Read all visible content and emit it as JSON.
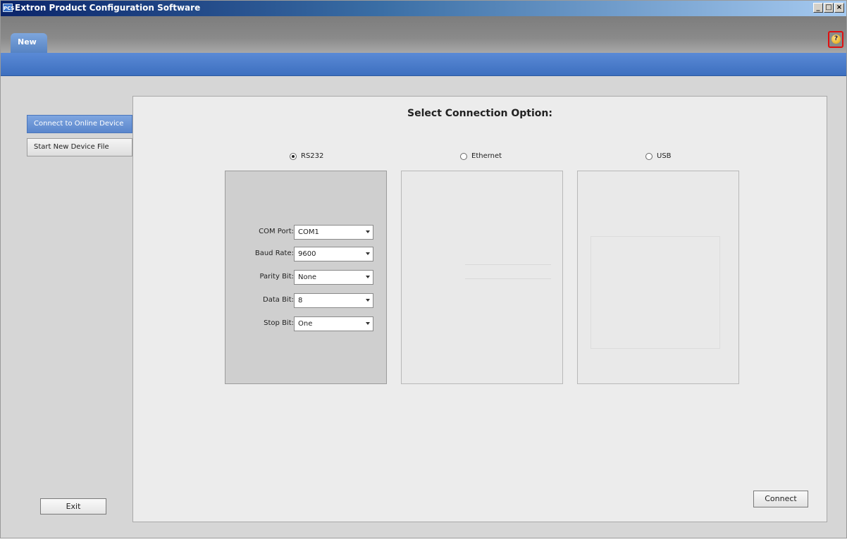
{
  "window": {
    "title": "Extron Product Configuration Software",
    "icon": "PCS"
  },
  "window_controls": {
    "minimize": "_",
    "maximize": "□",
    "close": "×"
  },
  "tabs": [
    {
      "label": "New"
    }
  ],
  "help": {
    "label": "?"
  },
  "sidebar": {
    "items": [
      {
        "label": "Connect to Online Device",
        "active": true
      },
      {
        "label": "Start New Device File",
        "active": false
      }
    ]
  },
  "exit_label": "Exit",
  "main": {
    "heading": "Select Connection Option:",
    "options": [
      {
        "label": "RS232",
        "selected": true
      },
      {
        "label": "Ethernet",
        "selected": false
      },
      {
        "label": "USB",
        "selected": false
      }
    ],
    "rs232_fields": [
      {
        "label": "COM Port:",
        "value": "COM1"
      },
      {
        "label": "Baud Rate:",
        "value": "9600"
      },
      {
        "label": "Parity Bit:",
        "value": "None"
      },
      {
        "label": "Data Bit:",
        "value": "8"
      },
      {
        "label": "Stop Bit:",
        "value": "One"
      }
    ],
    "connect_label": "Connect"
  },
  "colors": {
    "title_bar": "#0a246a",
    "ribbon": "#4a7cc9",
    "active_item": "#5a86cc",
    "help_highlight": "#e01010"
  }
}
